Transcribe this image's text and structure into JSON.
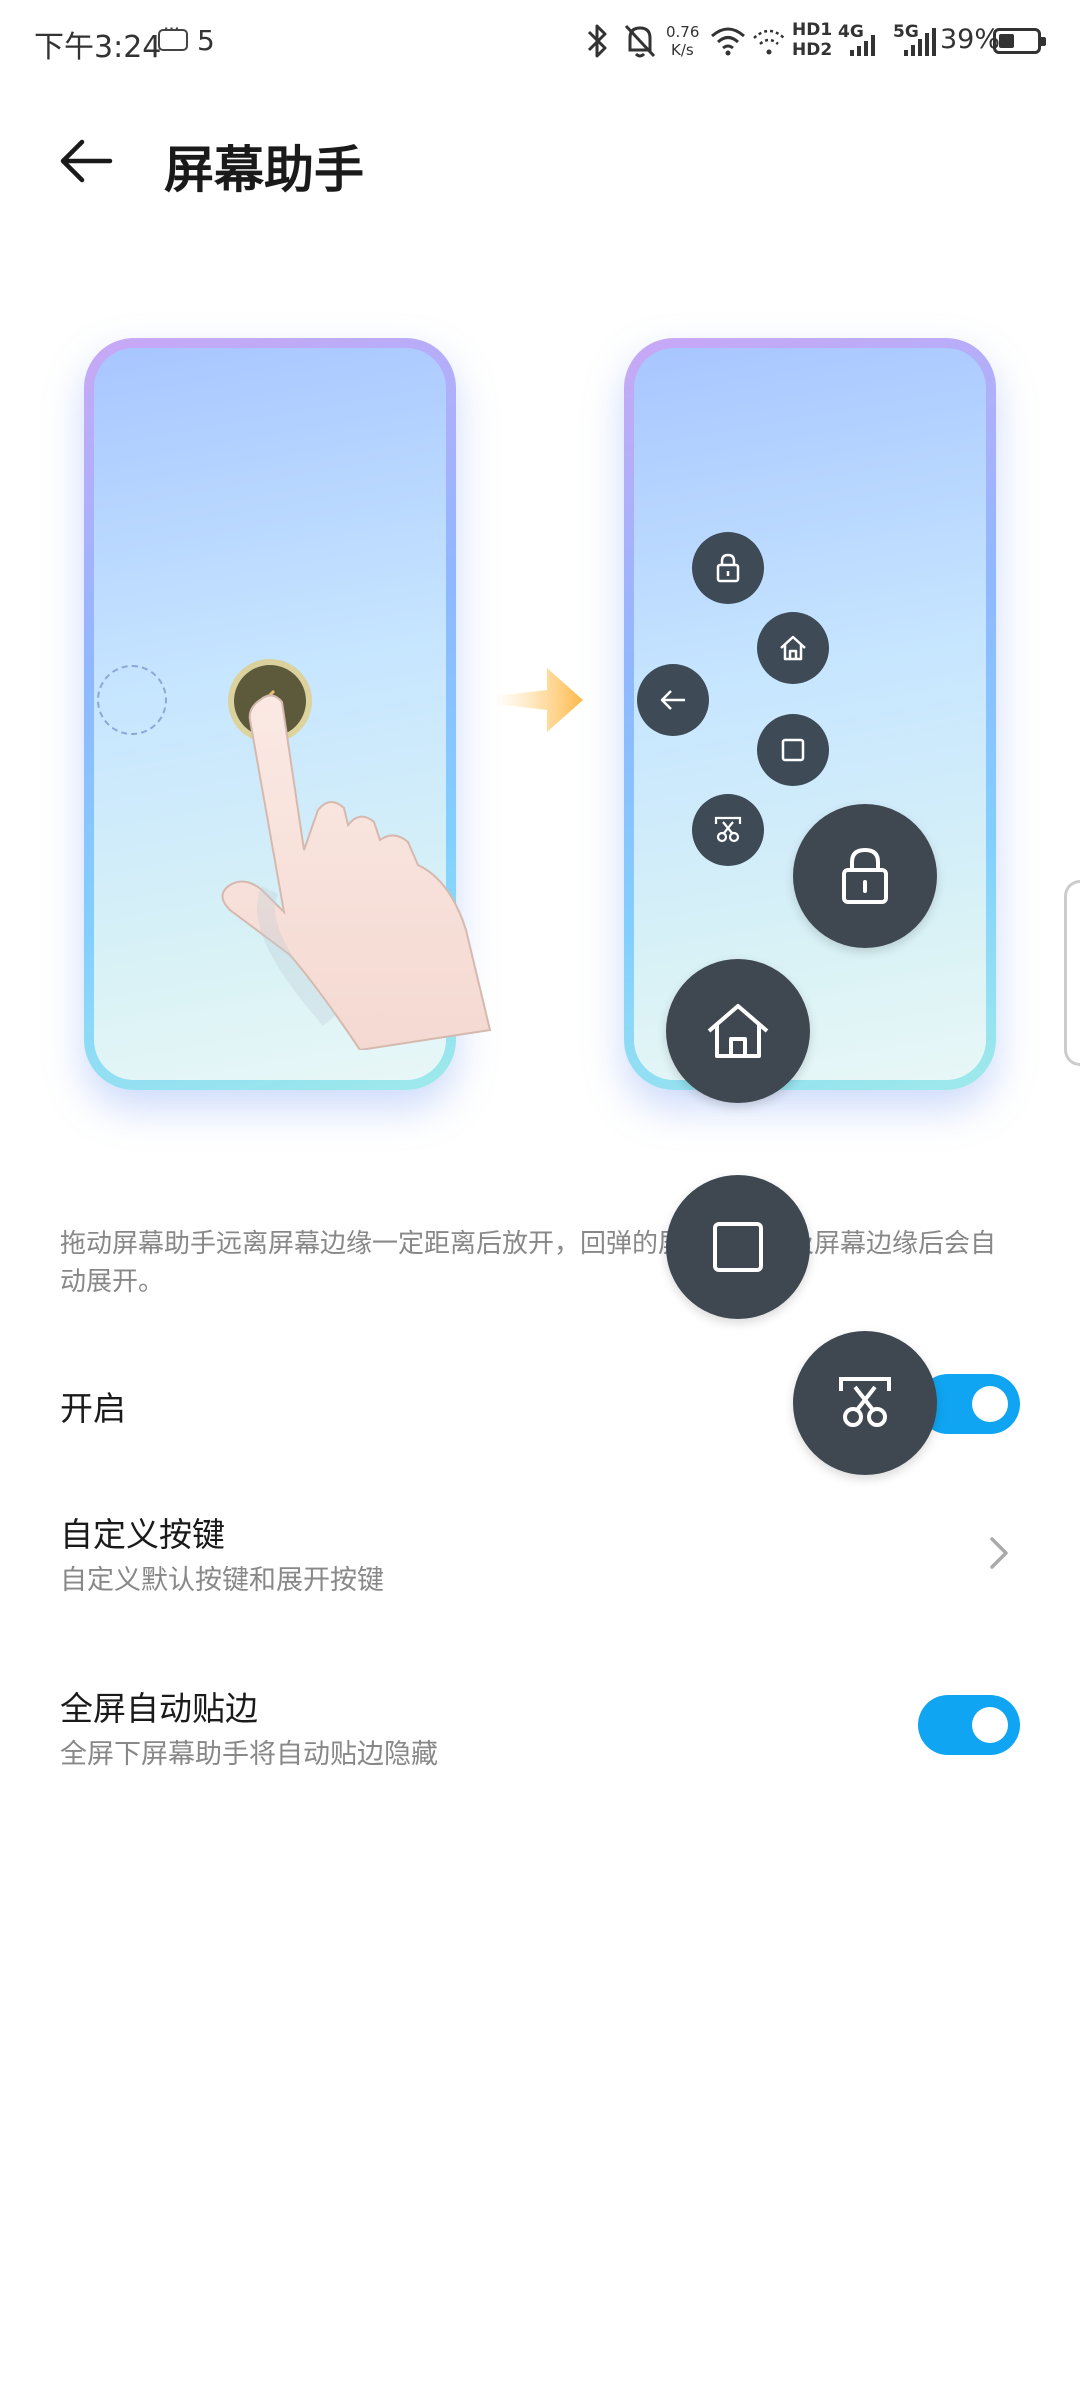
{
  "status_bar": {
    "time": "下午3:24",
    "notification_count": "5",
    "net_speed_value": "0.76",
    "net_speed_unit": "K/s",
    "hd1": "HD1",
    "hd2": "HD2",
    "sig1_label": "4G",
    "sig2_label": "5G",
    "battery_text": "39%",
    "battery_level": 0.39
  },
  "header": {
    "title": "屏幕助手"
  },
  "description": "拖动屏幕助手远离屏幕边缘一定距离后放开，回弹的屏幕助手触及屏幕边缘后会自动展开。",
  "settings": {
    "enable": {
      "label": "开启",
      "on": true
    },
    "custom_keys": {
      "label": "自定义按键",
      "sublabel": "自定义默认按键和展开按键"
    },
    "auto_edge": {
      "label": "全屏自动贴边",
      "sublabel": "全屏下屏幕助手将自动贴边隐藏",
      "on": true
    }
  },
  "colors": {
    "accent": "#0fa5f2",
    "floating_button": "#3f4851"
  },
  "floating_menu_icons": [
    "lock-icon",
    "home-icon",
    "recents-icon",
    "screenshot-icon"
  ],
  "illustration_icons": [
    "lock-icon",
    "home-icon",
    "back-icon",
    "recents-icon",
    "screenshot-icon"
  ]
}
